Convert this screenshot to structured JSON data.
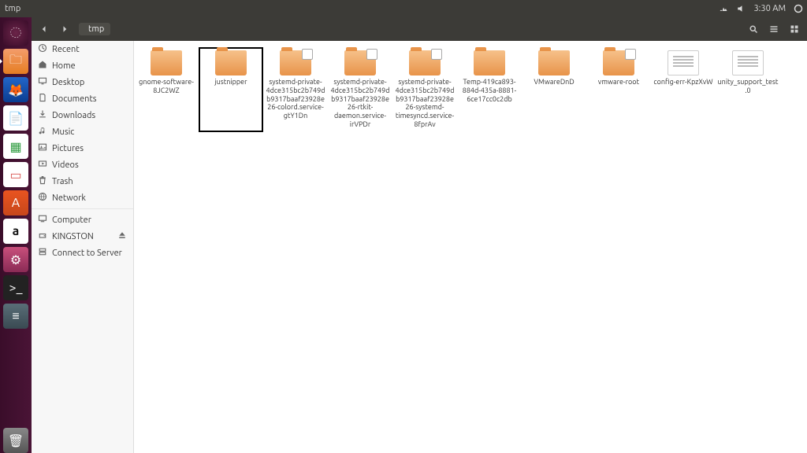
{
  "menubar": {
    "title": "tmp",
    "time": "3:30 AM"
  },
  "launcher": [
    {
      "name": "dash",
      "cls": "dash",
      "glyph": "◌"
    },
    {
      "name": "files",
      "cls": "files active",
      "glyph": "🗀"
    },
    {
      "name": "firefox",
      "cls": "ff",
      "glyph": "🦊"
    },
    {
      "name": "writer",
      "cls": "writer",
      "glyph": "📄"
    },
    {
      "name": "calc",
      "cls": "calc",
      "glyph": "▦"
    },
    {
      "name": "impress",
      "cls": "impress",
      "glyph": "▭"
    },
    {
      "name": "software",
      "cls": "ubuntu",
      "glyph": "A"
    },
    {
      "name": "amazon",
      "cls": "amazon",
      "glyph": "a"
    },
    {
      "name": "settings",
      "cls": "gear",
      "glyph": "⚙"
    },
    {
      "name": "terminal",
      "cls": "term",
      "glyph": ">_"
    },
    {
      "name": "sysmon",
      "cls": "sys",
      "glyph": "≡"
    }
  ],
  "launcher_trash": {
    "name": "trash",
    "cls": "trash",
    "glyph": "🗑"
  },
  "toolbar": {
    "path_label": "tmp"
  },
  "sidebar": {
    "places": [
      {
        "label": "Recent",
        "icon": "clock"
      },
      {
        "label": "Home",
        "icon": "home"
      },
      {
        "label": "Desktop",
        "icon": "desktop"
      },
      {
        "label": "Documents",
        "icon": "doc"
      },
      {
        "label": "Downloads",
        "icon": "down"
      },
      {
        "label": "Music",
        "icon": "music"
      },
      {
        "label": "Pictures",
        "icon": "pic"
      },
      {
        "label": "Videos",
        "icon": "vid"
      },
      {
        "label": "Trash",
        "icon": "trash"
      }
    ],
    "network_label": "Network",
    "devices": [
      {
        "label": "Computer",
        "icon": "computer"
      },
      {
        "label": "KINGSTON",
        "icon": "drive",
        "eject": true
      }
    ],
    "connect_label": "Connect to Server"
  },
  "files": [
    {
      "name": "gnome-software-8JC2WZ",
      "type": "folder"
    },
    {
      "name": "justnipper",
      "type": "folder",
      "selected": true
    },
    {
      "name": "systemd-private-4dce315bc2b749db9317baaf23928e26-colord.service-gtY1Dn",
      "type": "folder-locked"
    },
    {
      "name": "systemd-private-4dce315bc2b749db9317baaf23928e26-rtkit-daemon.service-irVPDr",
      "type": "folder-locked"
    },
    {
      "name": "systemd-private-4dce315bc2b749db9317baaf23928e26-systemd-timesyncd.service-8fprAv",
      "type": "folder-locked"
    },
    {
      "name": "Temp-419ca893-884d-435a-8881-6ce17cc0c2db",
      "type": "folder"
    },
    {
      "name": "VMwareDnD",
      "type": "folder"
    },
    {
      "name": "vmware-root",
      "type": "folder-locked"
    },
    {
      "name": "config-err-KpzXvW",
      "type": "file"
    },
    {
      "name": "unity_support_test.0",
      "type": "file"
    }
  ]
}
